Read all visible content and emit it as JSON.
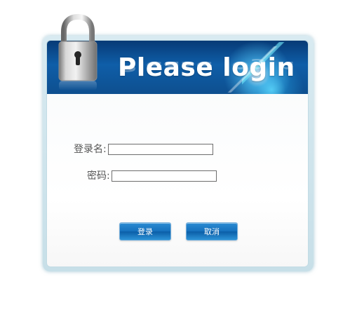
{
  "window": {
    "title": "Please login"
  },
  "form": {
    "username_label": "登录名:",
    "username_value": "",
    "password_label": "密码:",
    "password_value": ""
  },
  "buttons": {
    "login_label": "登录",
    "cancel_label": "取消"
  },
  "icons": {
    "lock": "lock-icon"
  },
  "colors": {
    "banner_blue": "#0f5ea8",
    "button_blue": "#1671bd",
    "panel_border": "#c2dbe4"
  }
}
